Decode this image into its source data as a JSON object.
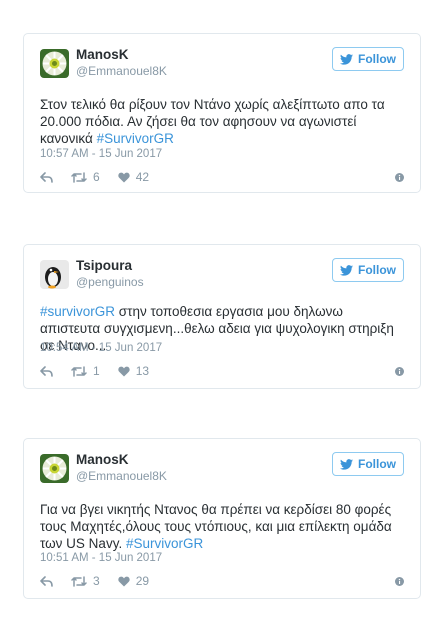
{
  "follow_label": "Follow",
  "accent_color": "#3b94d9",
  "tweets": [
    {
      "name": "ManosK",
      "handle": "@Emmanouel8K",
      "text_main": "Στον τελικό θα ρίξουν τον Ντάνο χωρίς αλεξίπτωτο απο τα 20.000 πόδια. Αν ζήσει θα τον αφησουν να αγωνιστεί κανονικά",
      "text_tag": "#SurvivorGR",
      "time": "10:57 AM - 15 Jun 2017",
      "retweets": "6",
      "likes": "42"
    },
    {
      "name": "Tsipoura",
      "handle": "@penguinos",
      "text_tag": "#survivorGR",
      "text_main": "στην τοποθεσια εργασια μου δηλωνω απιστευτα συγχισμενη...θελω αδεια για ψυχολογικη στηριξη σε Ντανο...",
      "time": "10:54 AM - 15 Jun 2017",
      "retweets": "1",
      "likes": "13"
    },
    {
      "name": "ManosK",
      "handle": "@Emmanouel8K",
      "text_main": "Για να βγει νικητής Ντανος θα πρέπει να κερδίσει 80 φορές τους Μαχητές,όλους τους ντόπιους, και μια επίλεκτη ομάδα των US Navy.",
      "text_tag": "#SurvivorGR",
      "time": "10:51 AM - 15 Jun 2017",
      "retweets": "3",
      "likes": "29"
    }
  ]
}
